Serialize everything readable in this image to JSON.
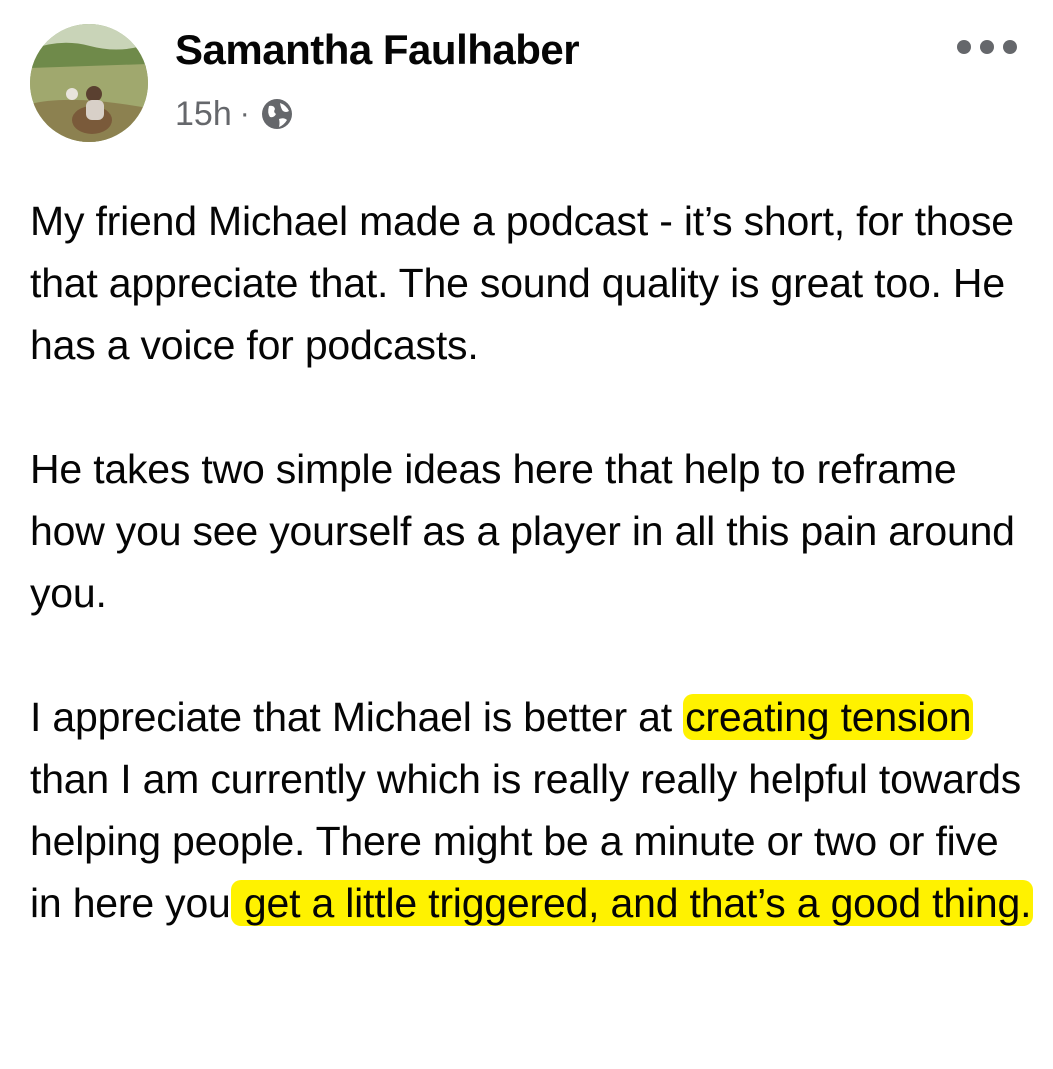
{
  "post": {
    "author": "Samantha Faulhaber",
    "time": "15h",
    "separator": "·",
    "privacy_icon": "globe-icon",
    "more_icon": "more-horizontal-icon",
    "colors": {
      "highlight": "#fff200",
      "meta_text": "#65676b",
      "body_text": "#050505"
    },
    "paragraphs": [
      "My friend Michael made a podcast - it’s short, for those that appreciate that. The sound quality is great too. He has a voice for podcasts.",
      "He takes two simple ideas here that help to reframe how you see yourself as a player in all this pain around you."
    ],
    "paragraph3": {
      "part1": "I appreciate that Michael is better at ",
      "highlight1": "creating tension ",
      "part2": "than I am currently which is really really helpful towards helping people. There might be a minute or two or five in here you",
      "highlight2": " get a little triggered, and that’s a good thing."
    }
  }
}
